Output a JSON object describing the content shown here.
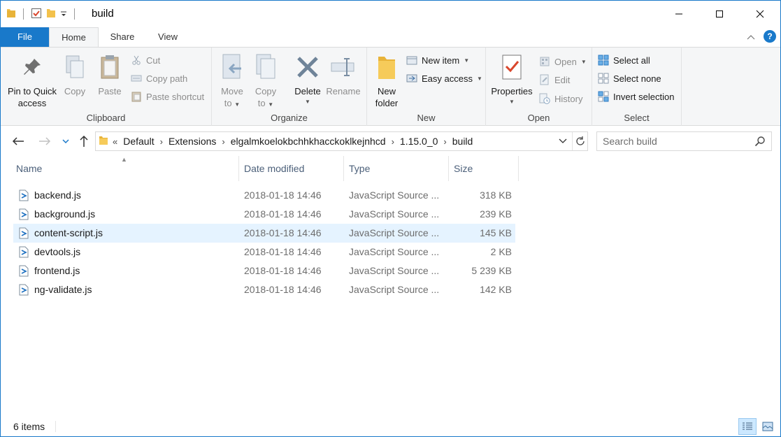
{
  "window": {
    "title": "build"
  },
  "ribbon_tabs": {
    "file": "File",
    "home": "Home",
    "share": "Share",
    "view": "View"
  },
  "clipboard": {
    "label": "Clipboard",
    "pin_line1": "Pin to Quick",
    "pin_line2": "access",
    "copy": "Copy",
    "paste": "Paste",
    "cut": "Cut",
    "copy_path": "Copy path",
    "paste_shortcut": "Paste shortcut"
  },
  "organize": {
    "label": "Organize",
    "move_line1": "Move",
    "move_line2": "to",
    "copy_line1": "Copy",
    "copy_line2": "to",
    "delete": "Delete",
    "rename": "Rename"
  },
  "new": {
    "label": "New",
    "new_folder_line1": "New",
    "new_folder_line2": "folder",
    "new_item": "New item",
    "easy_access": "Easy access"
  },
  "open": {
    "label": "Open",
    "properties": "Properties",
    "open": "Open",
    "edit": "Edit",
    "history": "History"
  },
  "select": {
    "label": "Select",
    "select_all": "Select all",
    "select_none": "Select none",
    "invert_selection": "Invert selection"
  },
  "address": {
    "overflow": "«",
    "crumbs": [
      "Default",
      "Extensions",
      "elgalmkoelokbchhkhacckoklkejnhcd",
      "1.15.0_0",
      "build"
    ]
  },
  "search": {
    "placeholder": "Search build"
  },
  "columns": {
    "name": "Name",
    "date": "Date modified",
    "type": "Type",
    "size": "Size"
  },
  "files": [
    {
      "name": "backend.js",
      "date": "2018-01-18 14:46",
      "type": "JavaScript Source ...",
      "size": "318 KB"
    },
    {
      "name": "background.js",
      "date": "2018-01-18 14:46",
      "type": "JavaScript Source ...",
      "size": "239 KB"
    },
    {
      "name": "content-script.js",
      "date": "2018-01-18 14:46",
      "type": "JavaScript Source ...",
      "size": "145 KB"
    },
    {
      "name": "devtools.js",
      "date": "2018-01-18 14:46",
      "type": "JavaScript Source ...",
      "size": "2 KB"
    },
    {
      "name": "frontend.js",
      "date": "2018-01-18 14:46",
      "type": "JavaScript Source ...",
      "size": "5 239 KB"
    },
    {
      "name": "ng-validate.js",
      "date": "2018-01-18 14:46",
      "type": "JavaScript Source ...",
      "size": "142 KB"
    }
  ],
  "status": {
    "count": "6 items"
  },
  "colors": {
    "accent": "#1979ca",
    "selected_row": "#e5f3ff",
    "folder": "#f3c14b"
  }
}
